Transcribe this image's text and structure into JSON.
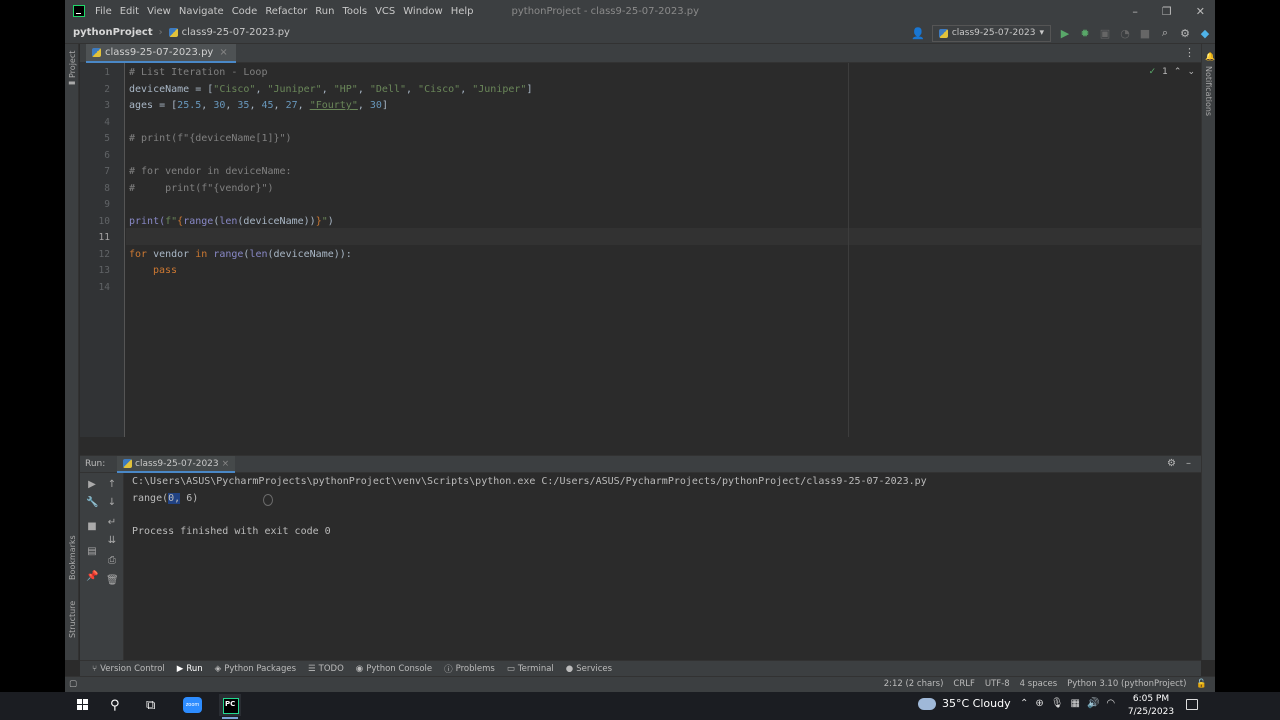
{
  "titlebar": {
    "menu": [
      "File",
      "Edit",
      "View",
      "Navigate",
      "Code",
      "Refactor",
      "Run",
      "Tools",
      "VCS",
      "Window",
      "Help"
    ],
    "title": "pythonProject - class9-25-07-2023.py"
  },
  "navbar": {
    "project": "pythonProject",
    "file": "class9-25-07-2023.py",
    "run_config": "class9-25-07-2023"
  },
  "side_strips": {
    "left": [
      "Project",
      "Bookmarks",
      "Structure"
    ],
    "right": [
      "Notifications"
    ]
  },
  "editor": {
    "tab": "class9-25-07-2023.py",
    "inspection_count": "1",
    "line_numbers": [
      "1",
      "2",
      "3",
      "4",
      "5",
      "6",
      "7",
      "8",
      "9",
      "10",
      "11",
      "12",
      "13",
      "14"
    ],
    "lines": {
      "l1": "# List Iteration - Loop",
      "l2_a": "deviceName = [",
      "l2_s1": "\"Cisco\"",
      "l2_s2": "\"Juniper\"",
      "l2_s3": "\"HP\"",
      "l2_s4": "\"Dell\"",
      "l2_s5": "\"Cisco\"",
      "l2_s6": "\"Juniper\"",
      "l2_b": "]",
      "comma": ", ",
      "l3_a": "ages = [",
      "l3_n1": "25.5",
      "l3_n2": "30",
      "l3_n3": "35",
      "l3_n4": "45",
      "l3_n5": "27",
      "l3_s": "\"Fourty\"",
      "l3_n6": "30",
      "l3_b": "]",
      "l5": "# print(f\"{deviceName[1]}\")",
      "l7": "# for vendor in deviceName:",
      "l8": "#     print(f\"{vendor}\")",
      "l10_print": "print(",
      "l10_f": "f\"",
      "l10_ob": "{",
      "l10_range": "range",
      "l10_p1": "(",
      "l10_len": "len",
      "l10_inner": "(deviceName))",
      "l10_cb": "}",
      "l10_q": "\"",
      "l10_end": ")",
      "l12_for": "for",
      "l12_vendor": " vendor ",
      "l12_in": "in",
      "l12_sp": " ",
      "l12_range": "range",
      "l12_p": "(",
      "l12_len": "len",
      "l12_rest": "(deviceName)):",
      "l13": "pass"
    }
  },
  "run": {
    "label": "Run:",
    "tab": "class9-25-07-2023",
    "cmd": "C:\\Users\\ASUS\\PycharmProjects\\pythonProject\\venv\\Scripts\\python.exe C:/Users/ASUS/PycharmProjects/pythonProject/class9-25-07-2023.py",
    "out_a": "range(",
    "out_sel": "0,",
    "out_b": " 6)",
    "exit": "Process finished with exit code 0"
  },
  "bottom_tabs": [
    "Version Control",
    "Run",
    "Python Packages",
    "TODO",
    "Python Console",
    "Problems",
    "Terminal",
    "Services"
  ],
  "status": {
    "selection": "2:12 (2 chars)",
    "line_sep": "CRLF",
    "encoding": "UTF-8",
    "indent": "4 spaces",
    "interpreter": "Python 3.10 (pythonProject)"
  },
  "taskbar": {
    "zoom_label": "zoom",
    "weather": "35°C  Cloudy",
    "time": "6:05 PM",
    "date": "7/25/2023"
  }
}
